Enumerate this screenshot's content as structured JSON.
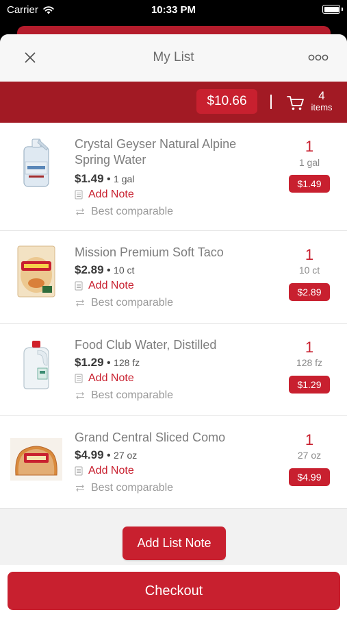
{
  "status_bar": {
    "carrier": "Carrier",
    "time": "10:33 PM"
  },
  "header": {
    "title": "My List"
  },
  "summary": {
    "total": "$10.66",
    "count": "4",
    "count_label": "items"
  },
  "items": [
    {
      "name": "Crystal Geyser Natural Alpine Spring Water",
      "price": "$1.49",
      "size": "1 gal",
      "note_label": "Add Note",
      "comparable_label": "Best comparable",
      "quantity": "1",
      "quantity_unit": "1 gal",
      "line_total": "$1.49",
      "thumb": "water-jug-icon"
    },
    {
      "name": "Mission Premium Soft Taco",
      "price": "$2.89",
      "size": "10 ct",
      "note_label": "Add Note",
      "comparable_label": "Best comparable",
      "quantity": "1",
      "quantity_unit": "10 ct",
      "line_total": "$2.89",
      "thumb": "tortilla-pack-icon"
    },
    {
      "name": "Food Club Water, Distilled",
      "price": "$1.29",
      "size": "128 fz",
      "note_label": "Add Note",
      "comparable_label": "Best comparable",
      "quantity": "1",
      "quantity_unit": "128 fz",
      "line_total": "$1.29",
      "thumb": "gallon-jug-icon"
    },
    {
      "name": "Grand Central Sliced Como",
      "price": "$4.99",
      "size": "27 oz",
      "note_label": "Add Note",
      "comparable_label": "Best comparable",
      "quantity": "1",
      "quantity_unit": "27 oz",
      "line_total": "$4.99",
      "thumb": "bread-loaf-icon"
    }
  ],
  "actions": {
    "add_list_note": "Add List Note",
    "checkout": "Checkout"
  },
  "colors": {
    "brand_red": "#c8202f",
    "summary_bar": "#a21a24"
  }
}
